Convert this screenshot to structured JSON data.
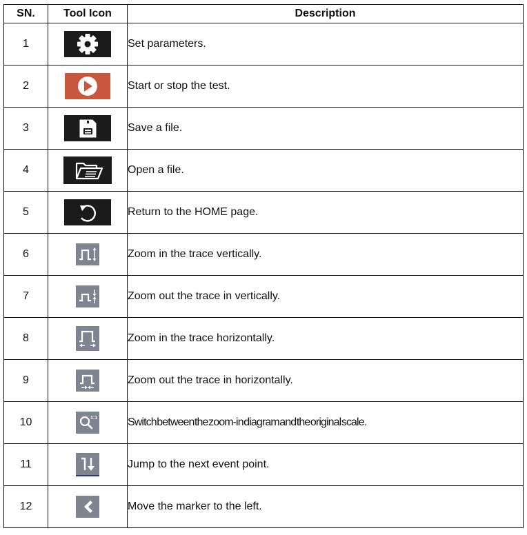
{
  "table": {
    "headers": [
      "SN.",
      "Tool Icon",
      "Description"
    ],
    "rows": [
      {
        "sn": "1",
        "icon": "gear-icon",
        "description": "Set parameters."
      },
      {
        "sn": "2",
        "icon": "play-icon",
        "description": "Start or stop the test."
      },
      {
        "sn": "3",
        "icon": "save-floppy-icon",
        "description": "Save a file."
      },
      {
        "sn": "4",
        "icon": "open-folder-icon",
        "description": "Open a file."
      },
      {
        "sn": "5",
        "icon": "return-home-icon",
        "description": "Return to the HOME page."
      },
      {
        "sn": "6",
        "icon": "zoom-in-vertical-icon",
        "description": "Zoom in the trace vertically."
      },
      {
        "sn": "7",
        "icon": "zoom-out-vertical-icon",
        "description": "Zoom out the trace in vertically."
      },
      {
        "sn": "8",
        "icon": "zoom-in-horizontal-icon",
        "description": "Zoom in the trace horizontally."
      },
      {
        "sn": "9",
        "icon": "zoom-out-horizontal-icon",
        "description": "Zoom out the trace in horizontally."
      },
      {
        "sn": "10",
        "icon": "zoom-original-scale-icon",
        "description": "Switch between the zoom-in diagram and the original scale."
      },
      {
        "sn": "11",
        "icon": "next-event-icon",
        "description": "Jump to the next event point."
      },
      {
        "sn": "12",
        "icon": "marker-left-icon",
        "description": "Move the marker to the left."
      }
    ]
  },
  "colors": {
    "dark_icon_bg": "#1b1b1b",
    "play_icon_bg": "#c9573d",
    "gray_icon_bg": "#7f8491",
    "icon_fg": "#ffffff"
  }
}
